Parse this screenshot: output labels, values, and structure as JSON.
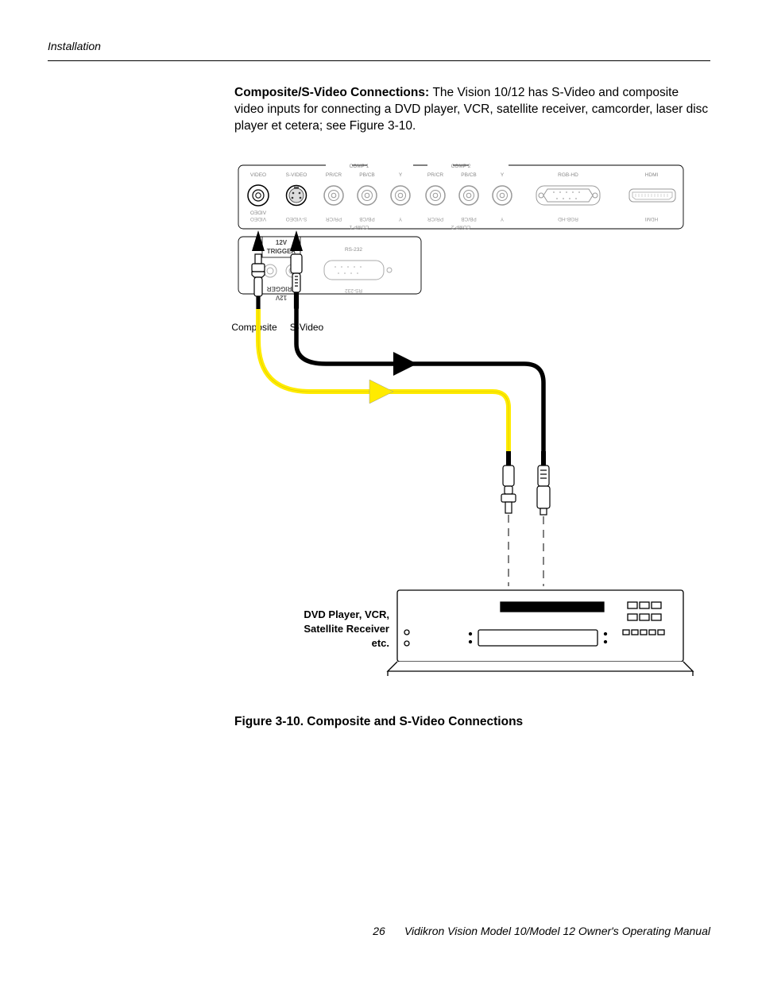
{
  "header": {
    "section": "Installation"
  },
  "body": {
    "lead_bold": "Composite/S-Video Connections: ",
    "lead_rest": "The Vision 10/12 has S-Video and composite video inputs for connecting a DVD player, VCR, satellite receiver, camcorder, laser disc player et cetera; see Figure 3-10."
  },
  "diagram": {
    "top_panel": {
      "comp1": "COMP 1",
      "comp2": "COMP 2",
      "video": "VIDEO",
      "svideo": "S-VIDEO",
      "prcr": "PR/CR",
      "pbcb": "PB/CB",
      "y": "Y",
      "rgbhd": "RGB-HD",
      "hdmi": "HDMI"
    },
    "bot_panel": {
      "trigger_top": "12V",
      "trigger_bot": "TRIGGER",
      "rs232": "RS-232"
    },
    "cable_labels": {
      "composite": "Composite",
      "svideo": "S-Video"
    },
    "device": {
      "l1": "DVD Player, VCR,",
      "l2": "Satellite Receiver",
      "l3": "etc."
    }
  },
  "figure_caption": "Figure 3-10. Composite and S-Video Connections",
  "footer": {
    "page_number": "26",
    "title": "Vidikron Vision Model 10/Model 12 Owner's Operating Manual"
  }
}
